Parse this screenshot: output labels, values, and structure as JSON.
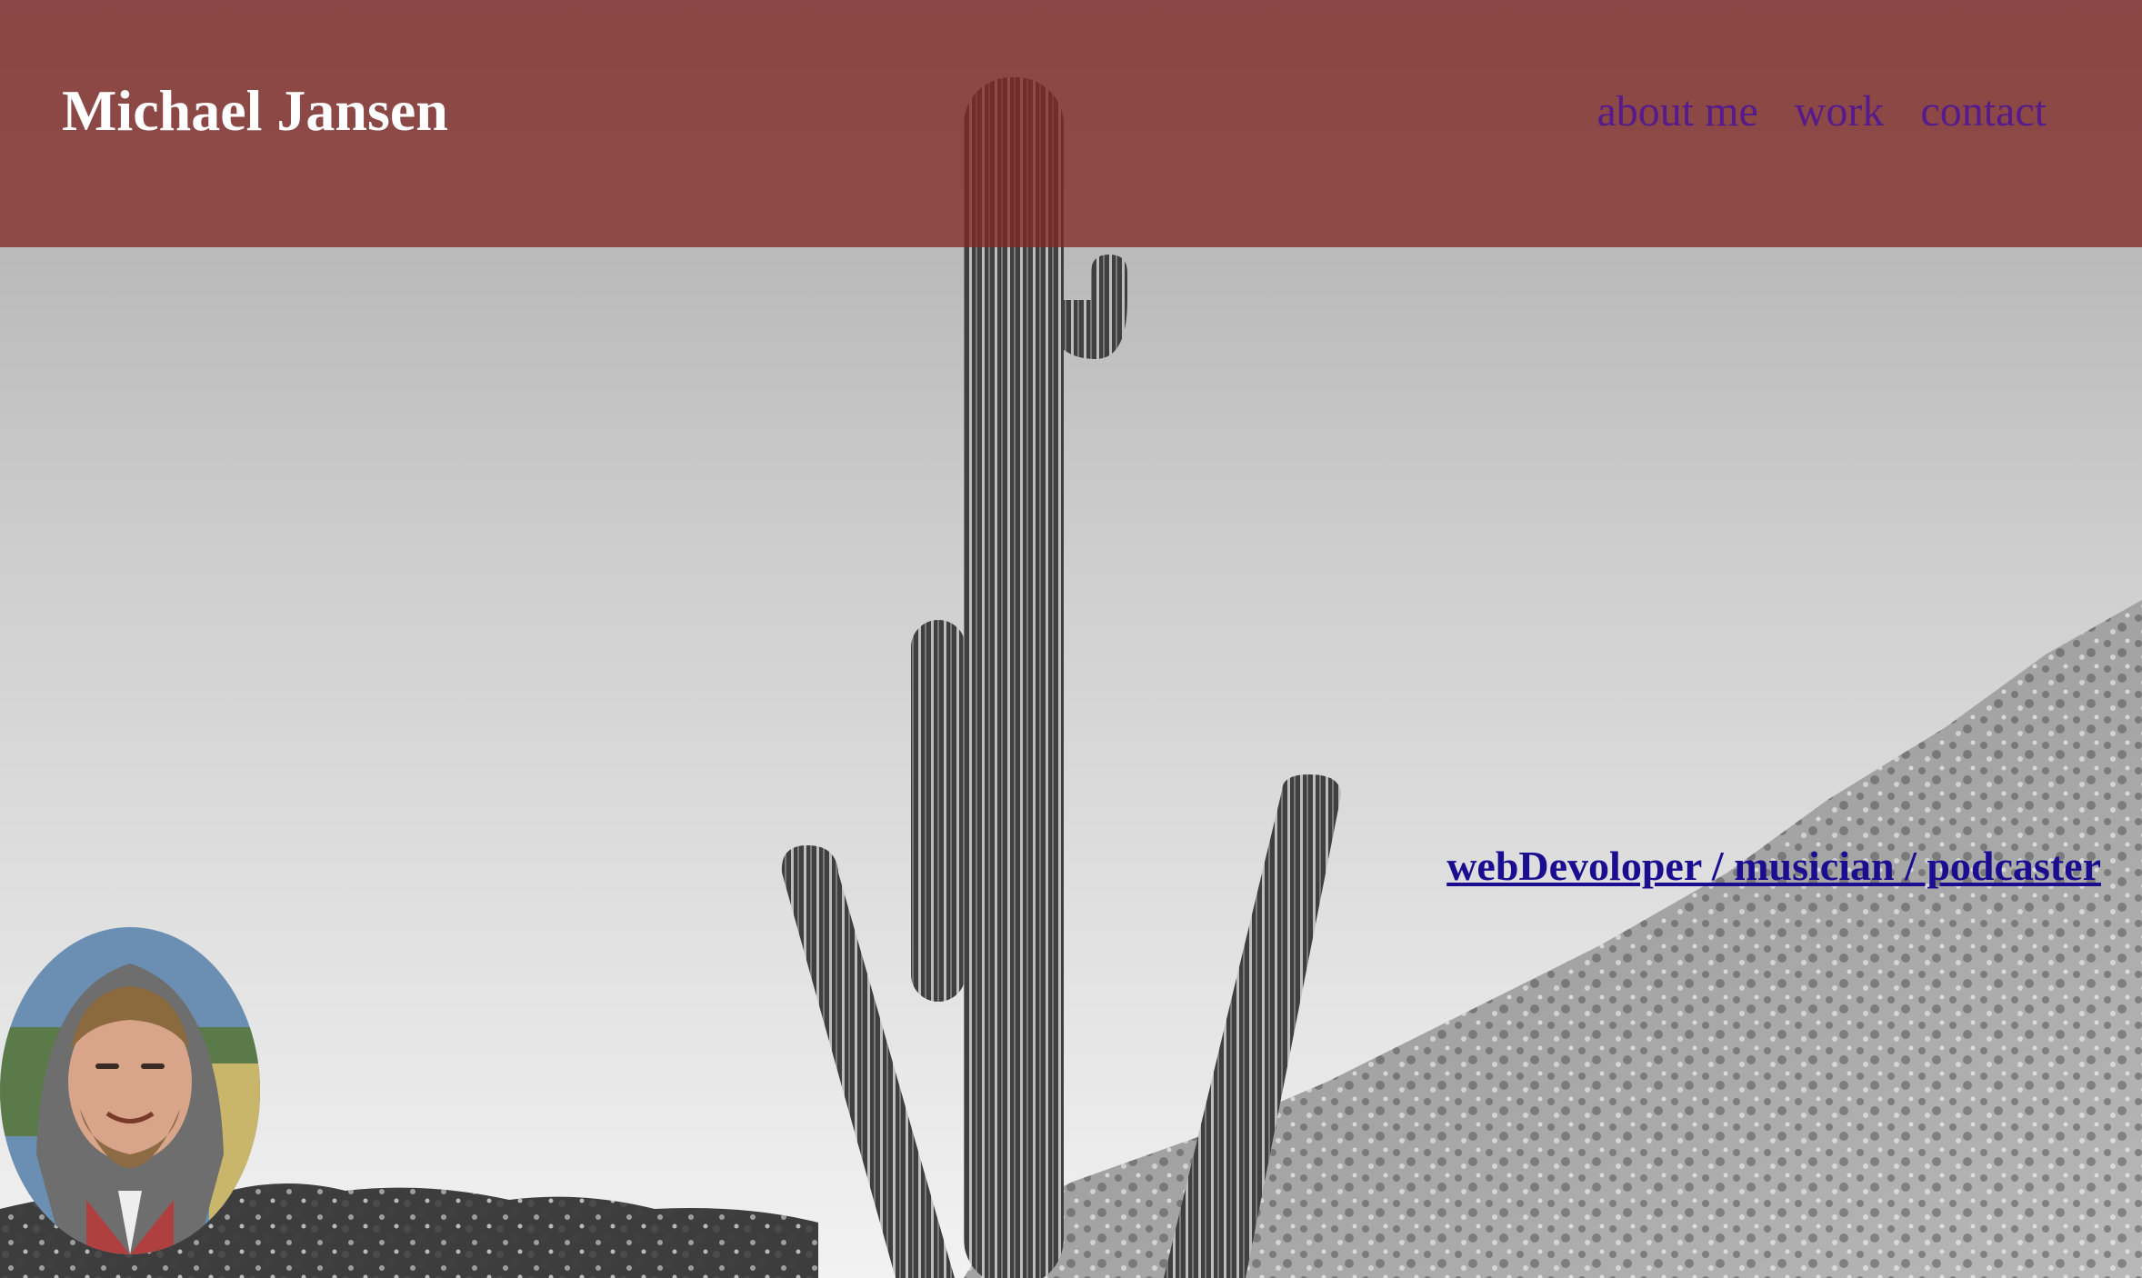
{
  "header": {
    "site_title": "Michael Jansen",
    "nav": [
      {
        "label": "about me"
      },
      {
        "label": "work"
      },
      {
        "label": "contact"
      }
    ]
  },
  "hero": {
    "background_image": "black-and-white desert with saguaro cactus",
    "tagline": "webDevoloper / musician / podcaster"
  },
  "profile": {
    "avatar_image": "profile photo"
  },
  "colors": {
    "header_overlay": "#802824",
    "title_text": "#ffffff",
    "nav_link": "#551a8b",
    "tagline_link": "#1a0d8f"
  }
}
